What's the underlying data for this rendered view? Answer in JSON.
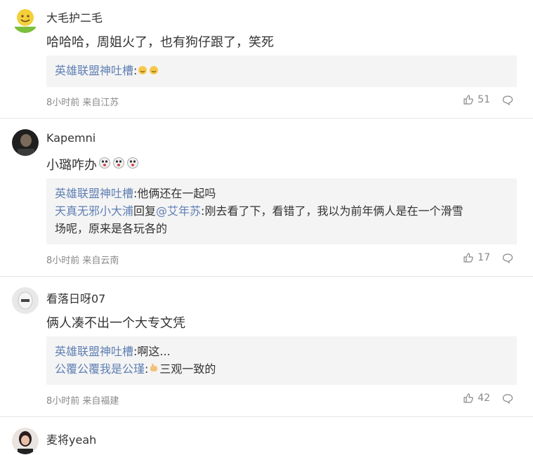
{
  "comments": [
    {
      "username": "大毛护二毛",
      "text": "哈哈哈，周姐火了，也有狗仔跟了，笑死",
      "replies": [
        {
          "name": "英雄联盟神吐槽",
          "sep": ":",
          "text": ""
        }
      ],
      "meta": "8小时前 来自江苏",
      "likes": "51",
      "avatar_color": "#c7d94a"
    },
    {
      "username": "Kapemni",
      "text": "小璐咋办",
      "replies": [
        {
          "name": "英雄联盟神吐槽",
          "sep": ":",
          "text": "他俩还在一起吗"
        },
        {
          "name": "天真无邪小大浦",
          "mid": "回复",
          "mention": "@艾年苏",
          "sep": ":",
          "text": "刚去看了下，看错了，我以为前年俩人是在一个滑雪",
          "cont": "场呢，原来是各玩各的"
        }
      ],
      "meta": "8小时前 来自云南",
      "likes": "17",
      "avatar_color": "#2b2b2b"
    },
    {
      "username": "看落日呀07",
      "text": "俩人凑不出一个大专文凭",
      "replies": [
        {
          "name": "英雄联盟神吐槽",
          "sep": ":",
          "text": "啊这..."
        },
        {
          "name": "公覆公覆我是公瑾",
          "sep": ":",
          "text": "三观一致的"
        }
      ],
      "meta": "8小时前 来自福建",
      "likes": "42",
      "avatar_color": "#d8d8d8"
    },
    {
      "username": "麦将yeah",
      "avatar_color": "#3a2a2a"
    }
  ],
  "icons": {
    "like": "thumbs-up-icon",
    "reply": "comment-bubble-icon"
  }
}
